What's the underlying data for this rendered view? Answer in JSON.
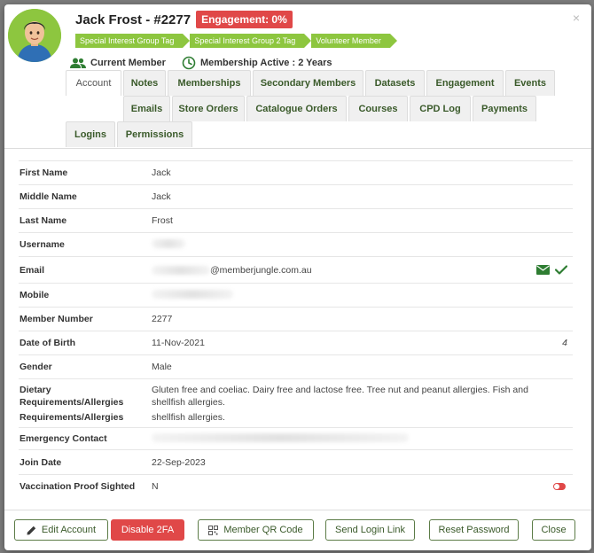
{
  "header": {
    "title": "Jack Frost - #2277",
    "engagement_badge": "Engagement: 0%",
    "tags": [
      "Special Interest Group Tag",
      "Special Interest Group 2 Tag",
      "Volunteer Member"
    ],
    "status_member": "Current Member",
    "status_membership": "Membership Active : 2 Years",
    "close_symbol": "×"
  },
  "tabs": {
    "row1": [
      "Account",
      "Notes",
      "Memberships",
      "Secondary Members",
      "Datasets",
      "Engagement",
      "Events"
    ],
    "row2": [
      "Emails",
      "Store Orders",
      "Catalogue Orders",
      "Courses",
      "CPD Log",
      "Payments"
    ],
    "row3": [
      "Logins",
      "Permissions"
    ],
    "active": "Account"
  },
  "fields": {
    "first_name": {
      "label": "First Name",
      "value": "Jack"
    },
    "middle_name": {
      "label": "Middle Name",
      "value": "Jack"
    },
    "last_name": {
      "label": "Last Name",
      "value": "Frost"
    },
    "username": {
      "label": "Username",
      "value": ""
    },
    "email": {
      "label": "Email",
      "value": "@memberjungle.com.au"
    },
    "mobile": {
      "label": "Mobile",
      "value": ""
    },
    "member_number": {
      "label": "Member Number",
      "value": "2277"
    },
    "dob": {
      "label": "Date of Birth",
      "value": "11-Nov-2021",
      "extra": "4"
    },
    "gender": {
      "label": "Gender",
      "value": "Male"
    },
    "dietary": {
      "label_line1": "Dietary",
      "label_line2": "Requirements/Allergies",
      "label_line3": "Requirements/Allergies",
      "value_line1": "Gluten free and coeliac. Dairy free and lactose free. Tree nut and peanut allergies. Fish and",
      "value_line2": "shellfish allergies.",
      "value_line3": "shellfish allergies."
    },
    "emergency_contact": {
      "label": "Emergency Contact",
      "value": ""
    },
    "join_date": {
      "label": "Join Date",
      "value": "22-Sep-2023"
    },
    "vaccination": {
      "label": "Vaccination Proof Sighted",
      "value": "N"
    }
  },
  "footer": {
    "edit_account": "Edit Account",
    "disable_2fa": "Disable 2FA",
    "member_qr": "Member QR Code",
    "send_login": "Send Login Link",
    "reset_password": "Reset Password",
    "close": "Close"
  },
  "colors": {
    "accent_green": "#8dc63f",
    "button_border": "#5c7c47",
    "danger": "#e04848",
    "icon_green": "#2e7d32"
  },
  "icons": [
    "avatar",
    "users-icon",
    "clock-icon",
    "envelope-icon",
    "check-icon",
    "toggle-off-icon",
    "pencil-icon",
    "qr-icon"
  ]
}
